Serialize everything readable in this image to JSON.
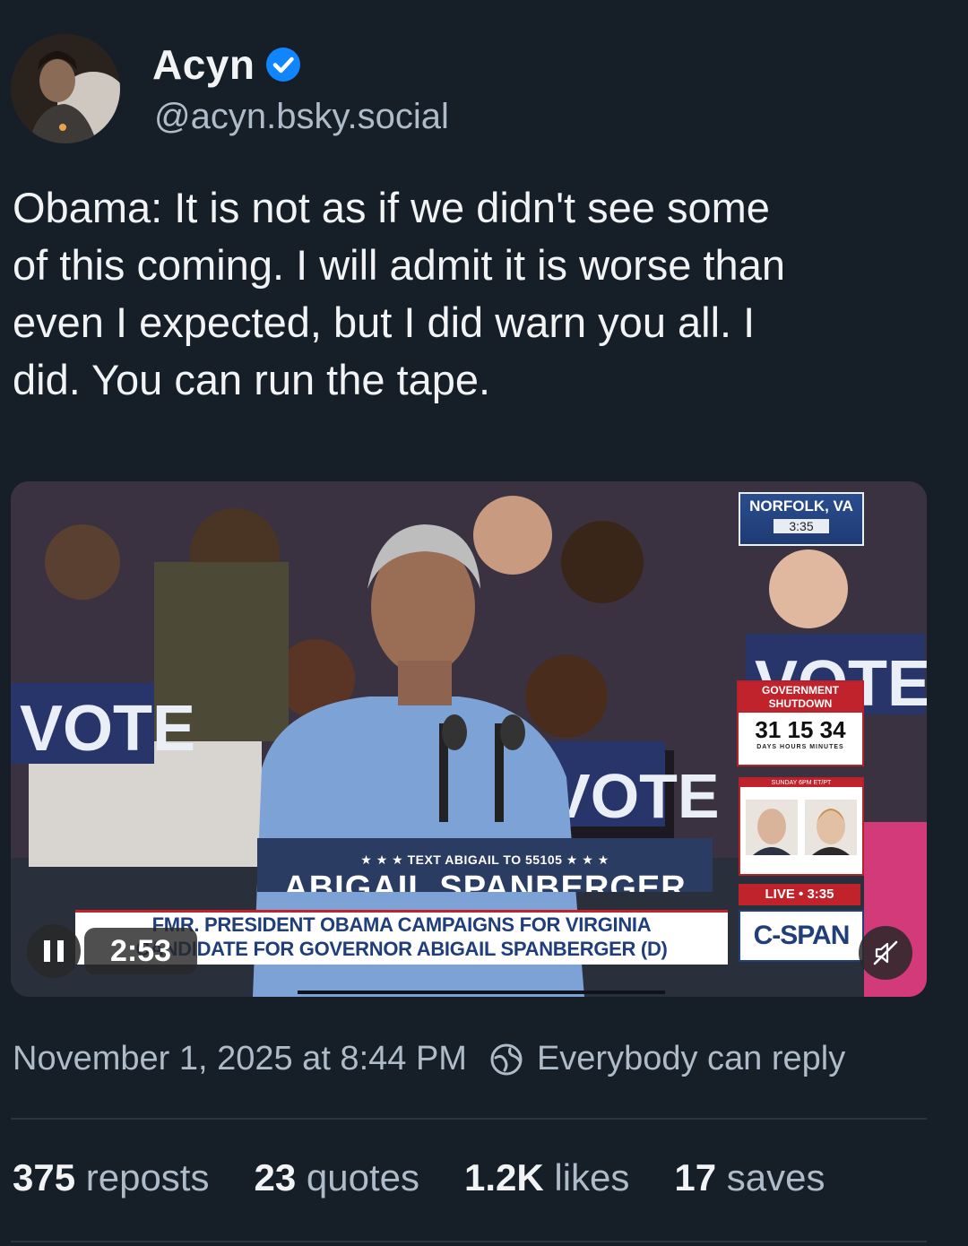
{
  "author": {
    "display_name": "Acyn",
    "handle": "@acyn.bsky.social",
    "verified": true
  },
  "post": {
    "text": "Obama: It is not as if we didn't see some\nof this coming. I will admit it is worse than\neven I expected, but I did warn you all. I\ndid. You can run the tape."
  },
  "video": {
    "location": "NORFOLK, VA",
    "location_time": "3:35",
    "shutdown_title": "GOVERNMENT SHUTDOWN",
    "shutdown_count": "31 15 34",
    "shutdown_units": "DAYS HOURS MINUTES",
    "bookclub_label": "SUNDAY 6PM ET/PT",
    "live_label": "LIVE • 3:35",
    "network": "C-SPAN",
    "podium_text": "★ ★ ★  TEXT ABIGAIL TO 55105  ★ ★ ★",
    "podium_name": "ABIGAIL SPANBERGER",
    "lower_third_line1": "FMR. PRESIDENT OBAMA CAMPAIGNS FOR VIRGINIA",
    "lower_third_line2": "CANDIDATE FOR GOVERNOR ABIGAIL SPANBERGER (D)",
    "elapsed": "2:53",
    "sign_vote": "VOTE"
  },
  "meta": {
    "timestamp": "November 1, 2025 at 8:44 PM",
    "reply_setting": "Everybody can reply"
  },
  "stats": {
    "reposts_count": "375",
    "reposts_label": "reposts",
    "quotes_count": "23",
    "quotes_label": "quotes",
    "likes_count": "1.2K",
    "likes_label": "likes",
    "saves_count": "17",
    "saves_label": "saves"
  },
  "colors": {
    "background": "#161e27",
    "text_primary": "#f1f3f5",
    "text_secondary": "#aebbc9",
    "verified_blue": "#1185fe",
    "cspan_red": "#c0232b",
    "cspan_blue": "#1f3e7a"
  }
}
